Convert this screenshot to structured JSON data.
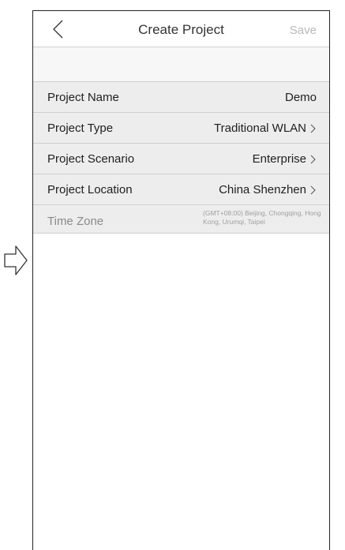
{
  "navbar": {
    "back_icon": "chevron-left-icon",
    "title": "Create Project",
    "save_label": "Save"
  },
  "rows": [
    {
      "label": "Project Name",
      "value": "Demo"
    },
    {
      "label": "Project Type",
      "value": "Traditional WLAN"
    },
    {
      "label": "Project Scenario",
      "value": "Enterprise"
    },
    {
      "label": "Project Location",
      "value": "China Shenzhen"
    },
    {
      "label": "Time Zone",
      "value": "(GMT+08:00) Beijing, Chongqing, Hong Kong, Urumqi, Taipei"
    }
  ],
  "colors": {
    "row_background": "#ededed",
    "save_disabled": "#b8b8b8",
    "divider": "#cfcfcf"
  }
}
